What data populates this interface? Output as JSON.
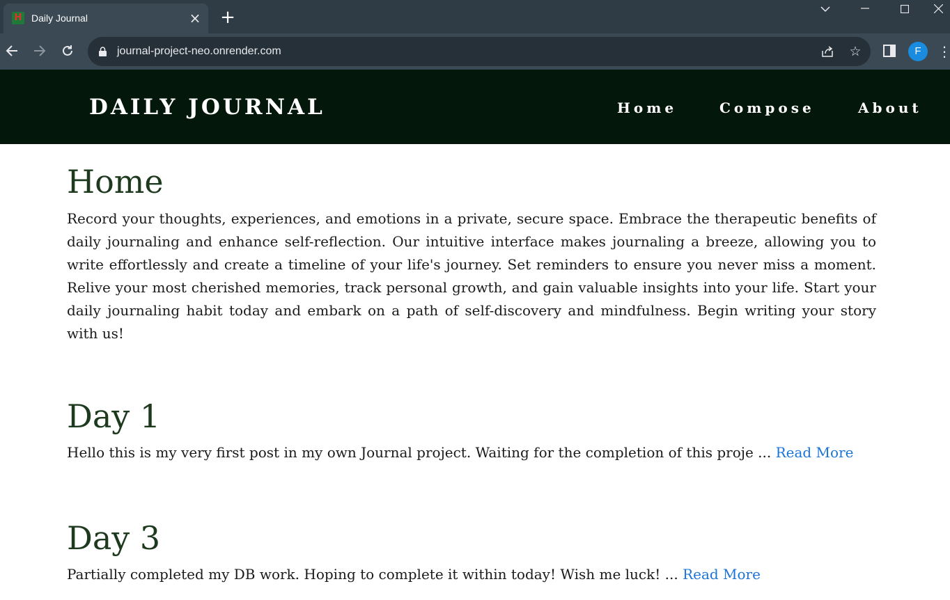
{
  "browser": {
    "tab_title": "Daily Journal",
    "favicon_letter": "H",
    "url": "journal-project-neo.onrender.com",
    "profile_initial": "F"
  },
  "site": {
    "brand": "DAILY JOURNAL",
    "nav": [
      "Home",
      "Compose",
      "About"
    ]
  },
  "main": {
    "title": "Home",
    "intro": "Record your thoughts, experiences, and emotions in a private, secure space. Embrace the therapeutic benefits of daily journaling and enhance self-reflection. Our intuitive interface makes journaling a breeze, allowing you to write effortlessly and create a timeline of your life's journey. Set reminders to ensure you never miss a moment. Relive your most cherished memories, track personal growth, and gain valuable insights into your life. Start your daily journaling habit today and embark on a path of self-discovery and mindfulness. Begin writing your story with us!",
    "posts": [
      {
        "title": "Day 1",
        "excerpt": "Hello this is my very first post in my own Journal project. Waiting for the completion of this proje ... ",
        "link": "Read More"
      },
      {
        "title": "Day 3",
        "excerpt": "Partially completed my DB work. Hoping to complete it within today! Wish me luck! ... ",
        "link": "Read More"
      }
    ]
  },
  "colors": {
    "navbar_bg": "#04170b",
    "heading": "#1d3a1f",
    "link": "#1a73d9",
    "chrome_bg": "#2f3b45"
  }
}
